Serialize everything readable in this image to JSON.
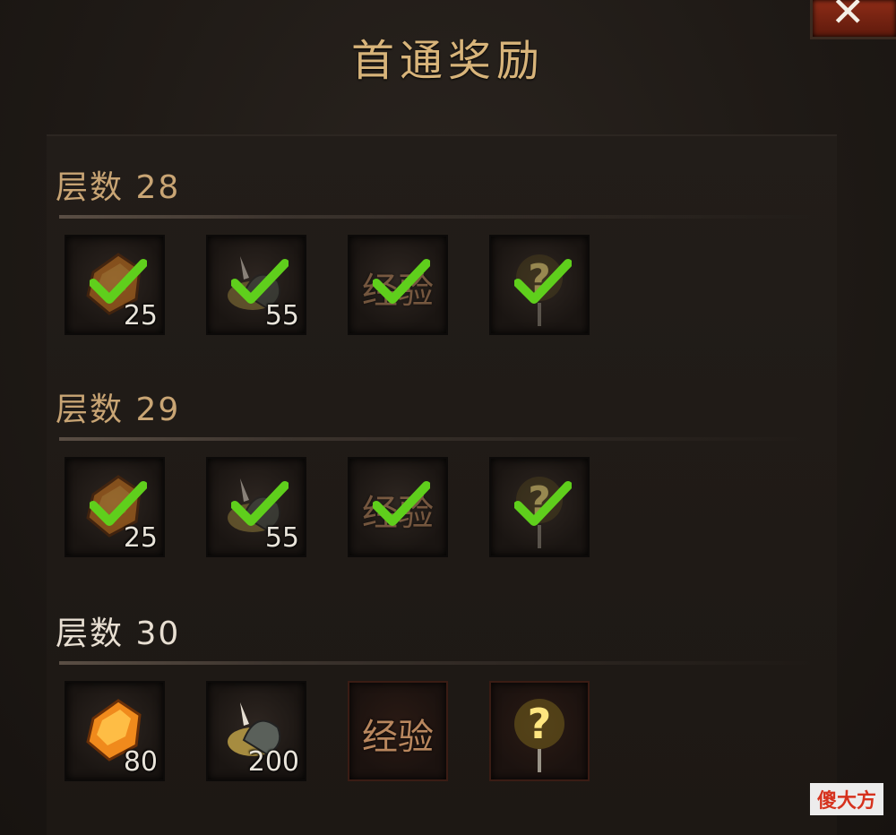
{
  "dialog": {
    "title": "首通奖励",
    "close_icon": "close-icon"
  },
  "floors": [
    {
      "label": "层数 28",
      "claimed": true,
      "rewards": [
        {
          "icon": "amber-gem-icon",
          "quantity": "25",
          "claimed": true
        },
        {
          "icon": "helmet-armor-icon",
          "quantity": "55",
          "claimed": true
        },
        {
          "icon": "experience-icon",
          "text": "经验",
          "claimed": true
        },
        {
          "icon": "mystery-reward-icon",
          "claimed": true
        }
      ]
    },
    {
      "label": "层数 29",
      "claimed": true,
      "rewards": [
        {
          "icon": "amber-gem-icon",
          "quantity": "25",
          "claimed": true
        },
        {
          "icon": "helmet-armor-icon",
          "quantity": "55",
          "claimed": true
        },
        {
          "icon": "experience-icon",
          "text": "经验",
          "claimed": true
        },
        {
          "icon": "mystery-reward-icon",
          "claimed": true
        }
      ]
    },
    {
      "label": "层数 30",
      "claimed": false,
      "rewards": [
        {
          "icon": "amber-gem-icon",
          "quantity": "80",
          "claimed": false
        },
        {
          "icon": "helmet-armor-icon",
          "quantity": "200",
          "claimed": false
        },
        {
          "icon": "experience-icon",
          "text": "经验",
          "claimed": false
        },
        {
          "icon": "mystery-reward-icon",
          "claimed": false
        }
      ]
    }
  ],
  "watermark": "傻大方",
  "colors": {
    "title": "#d8b47a",
    "floor_label": "#c9a574",
    "floor_label_active": "#e8dfd2",
    "check": "#5fcf1c",
    "close_button": "#8e2c17"
  }
}
